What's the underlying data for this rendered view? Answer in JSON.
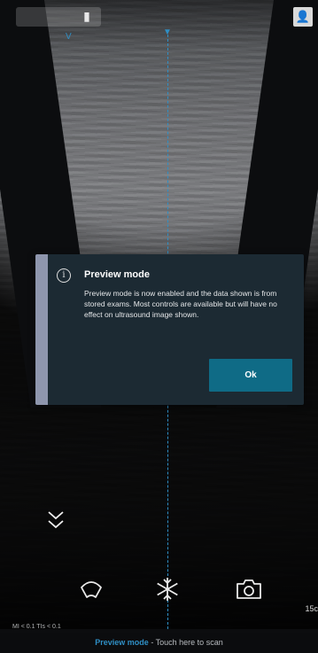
{
  "top": {
    "orientation_marker": "V"
  },
  "dialog": {
    "title": "Preview mode",
    "body": "Preview mode is now enabled and the data shown is from stored exams. Most controls are available but will have no effect on ultrasound image shown.",
    "ok_label": "Ok",
    "colors": {
      "background": "#1c2a33",
      "accent": "#8e96ad",
      "button": "#0f6b86"
    }
  },
  "controls": {
    "depth_chevrons_icon": "double-chevron-down-icon",
    "probe_mode_icon": "probe-fan-icon",
    "freeze_icon": "snowflake-icon",
    "capture_icon": "camera-icon"
  },
  "readout": {
    "mi_tis": "MI < 0.1  TIs < 0.1",
    "depth": "15c"
  },
  "bottom_bar": {
    "preview_label": "Preview mode",
    "separator": " - ",
    "touch_hint": "Touch here to scan"
  },
  "colors": {
    "accent_blue": "#2f8fc5",
    "app_background": "#0c0d0f"
  }
}
